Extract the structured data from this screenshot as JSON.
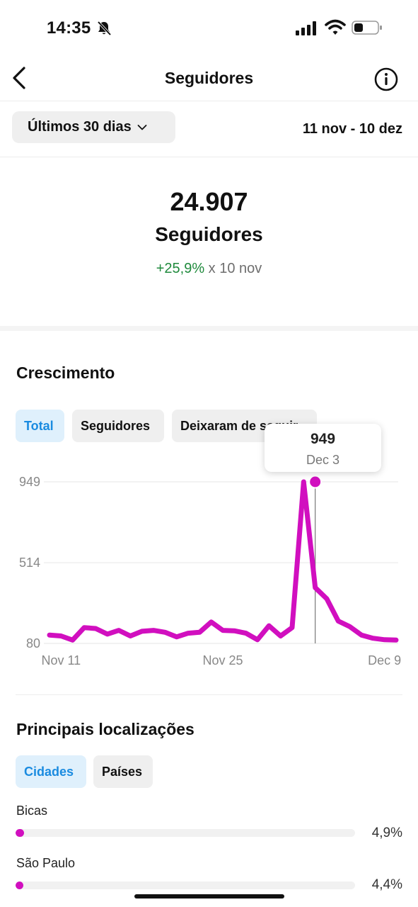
{
  "status_bar": {
    "time": "14:35"
  },
  "nav": {
    "title": "Seguidores"
  },
  "filter": {
    "range_label": "Últimos 30 dias",
    "date_range": "11 nov - 10 dez"
  },
  "summary": {
    "value": "24.907",
    "label": "Seguidores",
    "change_pct": "+25,9%",
    "change_ref": "x 10 nov"
  },
  "growth": {
    "title": "Crescimento",
    "tabs": [
      {
        "label": "Total",
        "active": true
      },
      {
        "label": "Seguidores",
        "active": false
      },
      {
        "label": "Deixaram de seguir",
        "active": false
      }
    ],
    "tooltip": {
      "value": "949",
      "date": "Dec 3"
    }
  },
  "chart_data": {
    "type": "line",
    "x": [
      "Nov 10",
      "Nov 11",
      "Nov 12",
      "Nov 13",
      "Nov 14",
      "Nov 15",
      "Nov 16",
      "Nov 17",
      "Nov 18",
      "Nov 19",
      "Nov 20",
      "Nov 21",
      "Nov 22",
      "Nov 23",
      "Nov 24",
      "Nov 25",
      "Nov 26",
      "Nov 27",
      "Nov 28",
      "Nov 29",
      "Nov 30",
      "Dec 1",
      "Dec 2",
      "Dec 3",
      "Dec 4",
      "Dec 5",
      "Dec 6",
      "Dec 7",
      "Dec 8",
      "Dec 9",
      "Dec 10"
    ],
    "series": [
      {
        "color": "#d10fbf",
        "values": [
          125,
          120,
          98,
          165,
          160,
          130,
          150,
          120,
          145,
          150,
          140,
          115,
          135,
          140,
          195,
          150,
          148,
          135,
          100,
          175,
          120,
          165,
          949,
          380,
          320,
          200,
          170,
          125,
          108,
          100,
          98
        ]
      }
    ],
    "y_ticks": [
      80,
      514,
      949
    ],
    "x_ticks": [
      "Nov 11",
      "Nov 25",
      "Dec 9"
    ],
    "ylim": [
      80,
      949
    ],
    "grid": true,
    "highlight": {
      "x": "Dec 3",
      "value": 949
    }
  },
  "locations": {
    "title": "Principais localizações",
    "tabs": [
      {
        "label": "Cidades",
        "active": true
      },
      {
        "label": "Países",
        "active": false
      }
    ],
    "items": [
      {
        "name": "Bicas",
        "percent_label": "4,9%",
        "percent": 4.9
      },
      {
        "name": "São Paulo",
        "percent_label": "4,4%",
        "percent": 4.4
      }
    ]
  }
}
